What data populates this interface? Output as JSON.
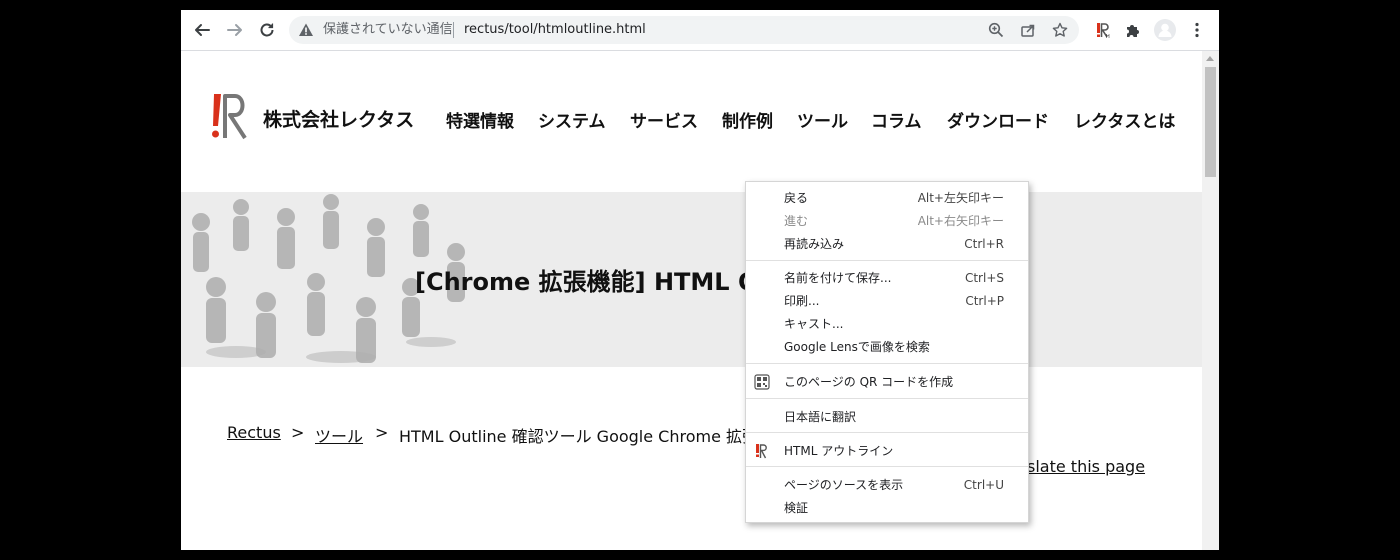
{
  "browser": {
    "security_status": "保護されていない通信",
    "url": "rectus/tool/htmloutline.html"
  },
  "site": {
    "company": "株式会社レクタス",
    "nav": [
      "特選情報",
      "システム",
      "サービス",
      "制作例",
      "ツール",
      "コラム",
      "ダウンロード",
      "レクタスとは"
    ],
    "hero_title": "[Chrome 拡張機能] HTML O",
    "breadcrumb": {
      "home": "Rectus",
      "sep1": ">",
      "tool": "ツール",
      "sep2": ">",
      "current": "HTML Outline 確認ツール Google Chrome 拡張"
    },
    "translate_link": "slate this page"
  },
  "context_menu": {
    "items": [
      {
        "label": "戻る",
        "shortcut": "Alt+左矢印キー"
      },
      {
        "label": "進む",
        "shortcut": "Alt+右矢印キー"
      },
      {
        "label": "再読み込み",
        "shortcut": "Ctrl+R"
      },
      {
        "label": "名前を付けて保存...",
        "shortcut": "Ctrl+S"
      },
      {
        "label": "印刷...",
        "shortcut": "Ctrl+P"
      },
      {
        "label": "キャスト..."
      },
      {
        "label": "Google Lensで画像を検索"
      },
      {
        "label": "このページの QR コードを作成"
      },
      {
        "label": "日本語に翻訳"
      },
      {
        "label": "HTML アウトライン"
      },
      {
        "label": "ページのソースを表示",
        "shortcut": "Ctrl+U"
      },
      {
        "label": "検証"
      }
    ]
  },
  "colors": {
    "logo_red": "#d9311b",
    "logo_gray": "#777777",
    "hero_bg": "#ececec"
  }
}
